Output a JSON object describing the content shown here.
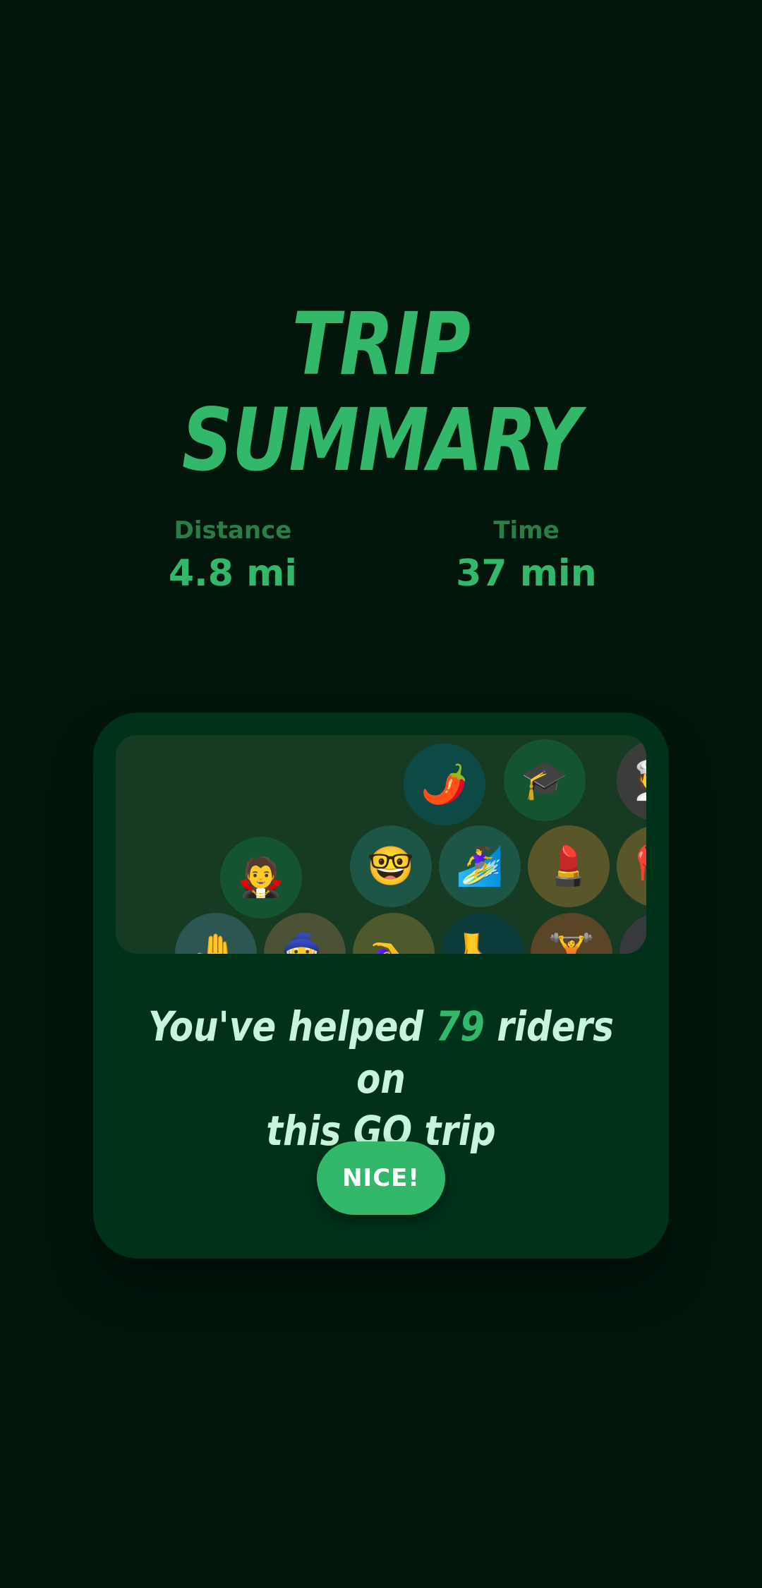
{
  "summary": {
    "title_line1": "TRIP",
    "title_line2": "SUMMARY"
  },
  "stats": {
    "distance_label": "Distance",
    "distance_value": "4.8 mi",
    "time_label": "Time",
    "time_value": "37 min"
  },
  "riders_card": {
    "message_prefix": "You've helped",
    "rider_count": "79",
    "message_suffix": "riders on",
    "message_line2": "this GO trip",
    "button_label": "NICE!",
    "rider_icons": [
      {
        "icon": "hot-pepper-icon",
        "glyph": "🌶️",
        "color": "#0e4a45"
      },
      {
        "icon": "graduation-cap-icon",
        "glyph": "🎓",
        "color": "#145430"
      },
      {
        "icon": "chef-icon",
        "glyph": "🧑‍🍳",
        "color": "#3b3d3a"
      },
      {
        "icon": "vampire-icon",
        "glyph": "🧛",
        "color": "#145430"
      },
      {
        "icon": "nerd-face-icon",
        "glyph": "🤓",
        "color": "#1d5546"
      },
      {
        "icon": "surfer-icon",
        "glyph": "🏄‍♀️",
        "color": "#1d5546"
      },
      {
        "icon": "lipstick-icon",
        "glyph": "💄",
        "color": "#59562a"
      },
      {
        "icon": "red-shoe-icon",
        "glyph": "👠",
        "color": "#59562a"
      },
      {
        "icon": "hand-icon",
        "glyph": "🤚",
        "color": "#2c5652"
      },
      {
        "icon": "mage-icon",
        "glyph": "🧙",
        "color": "#4b5233"
      },
      {
        "icon": "swimmer-icon",
        "glyph": "🏊‍♀️",
        "color": "#4e592c"
      },
      {
        "icon": "foot-icon",
        "glyph": "🦶",
        "color": "#0c3d3c"
      },
      {
        "icon": "weightlifter-icon",
        "glyph": "🏋️",
        "color": "#5b4527"
      },
      {
        "icon": "person-icon",
        "glyph": "🧍",
        "color": "#363a3f"
      }
    ]
  }
}
